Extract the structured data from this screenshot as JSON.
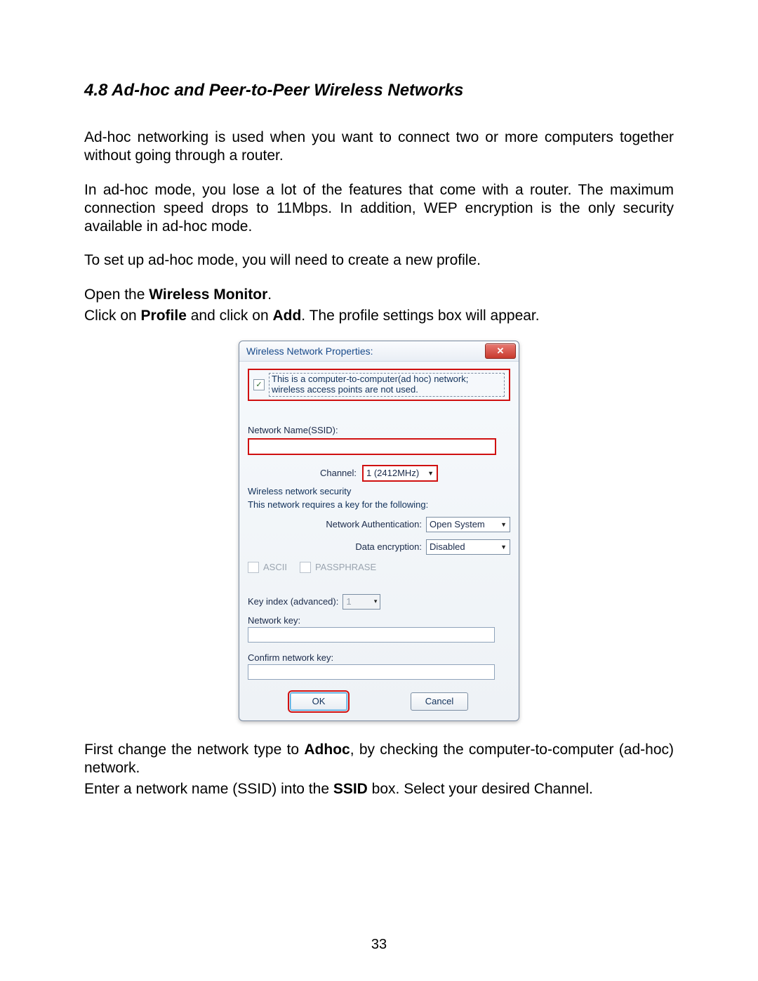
{
  "heading": "4.8 Ad-hoc and Peer-to-Peer Wireless Networks",
  "para1": "Ad-hoc networking is used when you want to connect two or more computers together without going through a router.",
  "para2": "In ad-hoc mode, you lose a lot of the features that come with a router. The maximum connection speed drops to 11Mbps. In addition, WEP encryption is the only security available in ad-hoc mode.",
  "para3": "To set up ad-hoc mode, you will need to create a new profile.",
  "open_pre": "Open the ",
  "open_bold": "Wireless Monitor",
  "open_post": ".",
  "click_pre": "Click on ",
  "click_b1": "Profile",
  "click_mid": " and click on ",
  "click_b2": "Add",
  "click_post": ". The profile settings box will appear.",
  "after1_pre": "First change the network type to ",
  "after1_bold": "Adhoc",
  "after1_post": ", by checking the computer-to-computer (ad-hoc) network.",
  "after2_pre": "Enter a network name (SSID) into the ",
  "after2_bold": "SSID",
  "after2_post": " box. Select your desired Channel.",
  "page_number": "33",
  "dialog": {
    "title": "Wireless Network Properties:",
    "close": "✕",
    "adhoc_chk": "✓",
    "adhoc_text": "This is a computer-to-computer(ad hoc) network; wireless access points are not used.",
    "ssid_label": "Network Name(SSID):",
    "channel_label": "Channel:",
    "channel_value": "1 (2412MHz)",
    "sec_head": "Wireless network security",
    "sec_sub": "This network requires a key for the following:",
    "auth_label": "Network Authentication:",
    "auth_value": "Open System",
    "enc_label": "Data encryption:",
    "enc_value": "Disabled",
    "ascii": "ASCII",
    "passphrase": "PASSPHRASE",
    "keyidx_label": "Key index (advanced):",
    "keyidx_value": "1",
    "netkey_label": "Network key:",
    "confirm_label": "Confirm network key:",
    "ok": "OK",
    "cancel": "Cancel"
  }
}
